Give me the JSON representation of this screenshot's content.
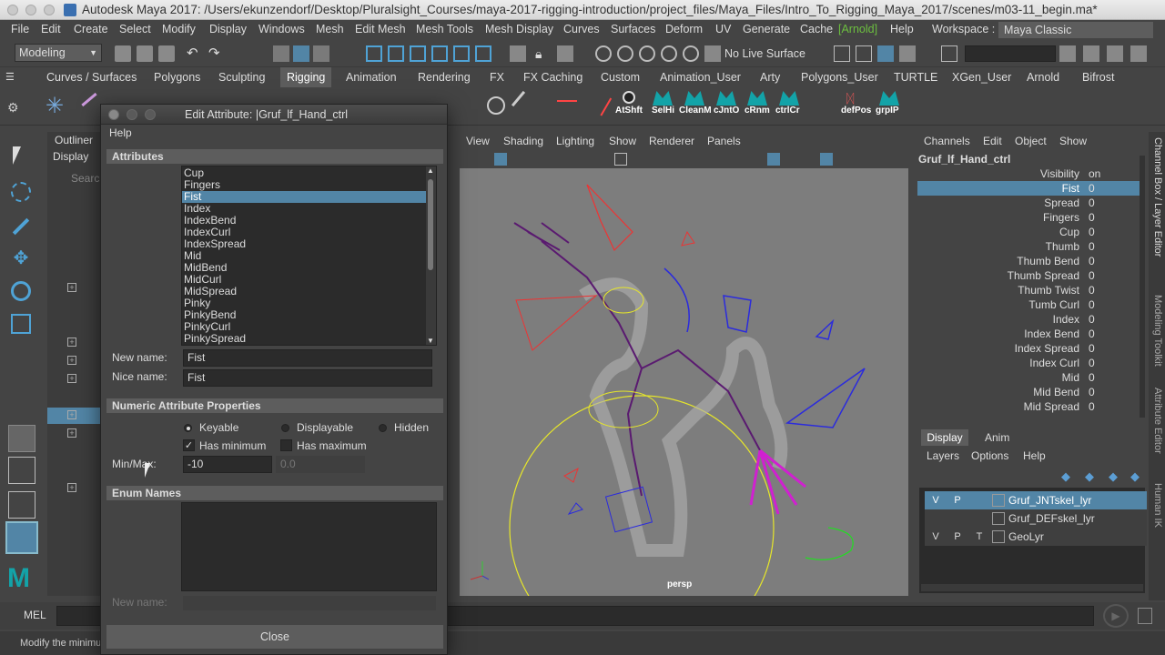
{
  "window": {
    "title": "Autodesk Maya 2017: /Users/ekunzendorf/Desktop/Pluralsight_Courses/maya-2017-rigging-introduction/project_files/Maya_Files/Intro_To_Rigging_Maya_2017/scenes/m03-11_begin.ma*"
  },
  "menu": [
    "File",
    "Edit",
    "Create",
    "Select",
    "Modify",
    "Display",
    "Windows",
    "Mesh",
    "Edit Mesh",
    "Mesh Tools",
    "Mesh Display",
    "Curves",
    "Surfaces",
    "Deform",
    "UV",
    "Generate",
    "Cache",
    "[Arnold]",
    "Help"
  ],
  "workspace": {
    "label": "Workspace :",
    "value": "Maya Classic"
  },
  "status": {
    "mode": "Modeling",
    "live_surface": "No Live Surface"
  },
  "shelf_tabs": [
    "Curves / Surfaces",
    "Polygons",
    "Sculpting",
    "Rigging",
    "Animation",
    "Rendering",
    "FX",
    "FX Caching",
    "Custom",
    "Animation_User",
    "Arty",
    "Polygons_User",
    "TURTLE",
    "XGen_User",
    "Arnold",
    "Bifrost"
  ],
  "shelf_active": "Rigging",
  "shelf_icons": [
    "AtShft",
    "SelHi",
    "CleanM",
    "cJntO",
    "cRnm",
    "ctrlCr",
    "defPos",
    "grpIP"
  ],
  "outliner": {
    "tabs": [
      "Outliner"
    ],
    "menus": [
      "Display"
    ],
    "search": "Search"
  },
  "viewport": {
    "menus": [
      "View",
      "Shading",
      "Lighting",
      "Show",
      "Renderer",
      "Panels"
    ],
    "camera": "persp"
  },
  "dialog": {
    "title": "Edit Attribute: |Gruf_lf_Hand_ctrl",
    "help": "Help",
    "attributes_header": "Attributes",
    "attributes": [
      "Cup",
      "Fingers",
      "Fist",
      "Index",
      "IndexBend",
      "IndexCurl",
      "IndexSpread",
      "Mid",
      "MidBend",
      "MidCurl",
      "MidSpread",
      "Pinky",
      "PinkyBend",
      "PinkyCurl",
      "PinkySpread"
    ],
    "selected_attribute": "Fist",
    "new_name_label": "New name:",
    "new_name_value": "Fist",
    "nice_name_label": "Nice name:",
    "nice_name_value": "Fist",
    "numeric_header": "Numeric Attribute Properties",
    "keyable": "Keyable",
    "displayable": "Displayable",
    "hidden": "Hidden",
    "has_minimum": "Has minimum",
    "has_maximum": "Has maximum",
    "minmax_label": "Min/Max:",
    "min_value": "-10",
    "max_value": "0.0",
    "enum_header": "Enum Names",
    "enum_new_name_label": "New name:",
    "close_label": "Close"
  },
  "channel_box": {
    "menus": [
      "Channels",
      "Edit",
      "Object",
      "Show"
    ],
    "object": "Gruf_lf_Hand_ctrl",
    "rows": [
      {
        "name": "Visibility",
        "value": "on"
      },
      {
        "name": "Fist",
        "value": "0"
      },
      {
        "name": "Spread",
        "value": "0"
      },
      {
        "name": "Fingers",
        "value": "0"
      },
      {
        "name": "Cup",
        "value": "0"
      },
      {
        "name": "Thumb",
        "value": "0"
      },
      {
        "name": "Thumb Bend",
        "value": "0"
      },
      {
        "name": "Thumb Spread",
        "value": "0"
      },
      {
        "name": "Thumb Twist",
        "value": "0"
      },
      {
        "name": "Tumb Curl",
        "value": "0"
      },
      {
        "name": "Index",
        "value": "0"
      },
      {
        "name": "Index Bend",
        "value": "0"
      },
      {
        "name": "Index Spread",
        "value": "0"
      },
      {
        "name": "Index Curl",
        "value": "0"
      },
      {
        "name": "Mid",
        "value": "0"
      },
      {
        "name": "Mid Bend",
        "value": "0"
      },
      {
        "name": "Mid Spread",
        "value": "0"
      }
    ],
    "selected_row": "Fist"
  },
  "layers": {
    "tabs": [
      "Display",
      "Anim"
    ],
    "menus": [
      "Layers",
      "Options",
      "Help"
    ],
    "rows": [
      {
        "v": "V",
        "p": "P",
        "t": "",
        "name": "Gruf_JNTskel_lyr"
      },
      {
        "v": "",
        "p": "",
        "t": "",
        "name": "Gruf_DEFskel_lyr"
      },
      {
        "v": "V",
        "p": "P",
        "t": "T",
        "name": "GeoLyr"
      }
    ],
    "selected_row": "Gruf_JNTskel_lyr"
  },
  "side_tabs": [
    "Channel Box / Layer Editor",
    "Modeling Toolkit",
    "Attribute Editor",
    "Human IK"
  ],
  "command_line": {
    "label": "MEL"
  },
  "help_line": "Modify the minimu",
  "colors": {
    "accent": "#5285a6",
    "panel": "#444444",
    "field": "#2b2b2b",
    "teal_icon": "#13a3a8",
    "arnold_green": "#6cbf3f"
  }
}
